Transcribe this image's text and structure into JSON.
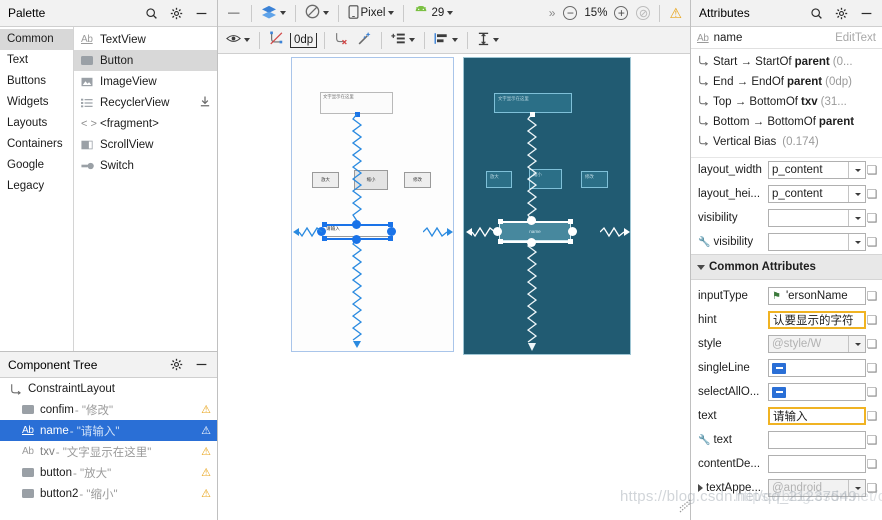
{
  "palette": {
    "header_title": "Palette",
    "icons": [
      "search-icon",
      "gear-icon",
      "minimize-icon"
    ],
    "categories": [
      {
        "label": "Common",
        "selected": true
      },
      {
        "label": "Text",
        "selected": false
      },
      {
        "label": "Buttons",
        "selected": false
      },
      {
        "label": "Widgets",
        "selected": false
      },
      {
        "label": "Layouts",
        "selected": false
      },
      {
        "label": "Containers",
        "selected": false
      },
      {
        "label": "Google",
        "selected": false
      },
      {
        "label": "Legacy",
        "selected": false
      }
    ],
    "items": [
      {
        "label": "TextView",
        "icon": "ab-text-icon",
        "selected": false,
        "download": false
      },
      {
        "label": "Button",
        "icon": "button-icon",
        "selected": true,
        "download": false
      },
      {
        "label": "ImageView",
        "icon": "image-icon",
        "selected": false,
        "download": false
      },
      {
        "label": "RecyclerView",
        "icon": "list-icon",
        "selected": false,
        "download": true
      },
      {
        "label": "<fragment>",
        "icon": "angle-brackets-icon",
        "selected": false,
        "download": false
      },
      {
        "label": "ScrollView",
        "icon": "scrollview-icon",
        "selected": false,
        "download": false
      },
      {
        "label": "Switch",
        "icon": "switch-icon",
        "selected": false,
        "download": false
      }
    ]
  },
  "component_tree": {
    "header_title": "Component Tree",
    "icons": [
      "gear-icon",
      "minimize-icon"
    ],
    "nodes": [
      {
        "name": "ConstraintLayout",
        "value": "",
        "icon": "constraint-icon",
        "depth": 0,
        "selected": false,
        "warning": "",
        "dim": false
      },
      {
        "name": "confim",
        "value": "- \"修改\"",
        "icon": "button-icon",
        "depth": 1,
        "selected": false,
        "warning": "⚠",
        "dim": false
      },
      {
        "name": "name",
        "value": "- \"请输入\"",
        "icon": "ab-text-icon",
        "depth": 1,
        "selected": true,
        "warning": "⚠",
        "dim": false
      },
      {
        "name": "txv",
        "value": "- \"文字显示在这里\"",
        "icon": "ab-text-icon",
        "depth": 1,
        "selected": false,
        "warning": "⚠",
        "dim": true
      },
      {
        "name": "button",
        "value": "- \"放大\"",
        "icon": "button-icon",
        "depth": 1,
        "selected": false,
        "warning": "⚠",
        "dim": false
      },
      {
        "name": "button2",
        "value": "- \"缩小\"",
        "icon": "button-icon",
        "depth": 1,
        "selected": false,
        "warning": "⚠",
        "dim": false
      }
    ]
  },
  "editor_toolbar": {
    "minimize_label": "—",
    "design_mode": "design-surface-icon",
    "orientation": "orientation-icon",
    "device_label": "Pixel",
    "device_icon": "phone-icon",
    "api_label": "29",
    "api_icon": "android-icon",
    "overflow_label": "»",
    "zoom_out_label": "−",
    "zoom_level": "15%",
    "zoom_in_label": "+",
    "zoom_fit_label": "⊘",
    "warning_icon": "warning-icon"
  },
  "constraint_toolbar": {
    "visibility_icon": "eye-icon",
    "autoconnect_icon": "autoconnect-off-icon",
    "margin_value": "0dp",
    "clear_constraints_icon": "clear-constraints-icon",
    "infer_icon": "magic-wand-icon",
    "pack_icon": "pack-icon",
    "align_icon": "align-icon",
    "guidelines_icon": "guidelines-icon"
  },
  "canvas": {
    "design_surface_title": "design-surface",
    "widgets": {
      "txv_text": "文字显示在这里",
      "button_zoom_in": "放大",
      "button_zoom_out": "缩小",
      "button_confirm": "修改",
      "edit_text": "请输入",
      "blueprint_edit_label": "name"
    }
  },
  "watermark": "https://blog.csdn.net/qq_21237549",
  "attributes": {
    "header_title": "Attributes",
    "icons": [
      "search-icon",
      "gear-icon",
      "minimize-icon"
    ],
    "selected_id": "name",
    "selected_type": "EditText",
    "constraints": [
      {
        "text": "Start → StartOf",
        "bold": "parent",
        "muted": "(0..."
      },
      {
        "text": "End → EndOf",
        "bold": "parent",
        "muted": "(0dp)"
      },
      {
        "text": "Top → BottomOf",
        "bold": "txv",
        "muted": "(31..."
      },
      {
        "text": "Bottom → BottomOf",
        "bold": "parent",
        "muted": ""
      },
      {
        "text": "Vertical Bias",
        "bold": "",
        "muted": "(0.174)"
      }
    ],
    "rows_top": [
      {
        "label": "layout_width",
        "value": "p_content",
        "kind": "dropdown",
        "highlight": false,
        "wrench": false
      },
      {
        "label": "layout_hei...",
        "value": "p_content",
        "kind": "dropdown",
        "highlight": false,
        "wrench": false
      },
      {
        "label": "visibility",
        "value": "",
        "kind": "dropdown",
        "highlight": false,
        "wrench": false
      },
      {
        "label": "visibility",
        "value": "",
        "kind": "dropdown",
        "highlight": false,
        "wrench": true
      }
    ],
    "section_common": "Common Attributes",
    "rows_common": [
      {
        "label": "inputType",
        "value": "'ersonName",
        "kind": "flag",
        "highlight": false,
        "wrench": false
      },
      {
        "label": "hint",
        "value": "认要显示的字符",
        "kind": "text",
        "highlight": true,
        "wrench": false
      },
      {
        "label": "style",
        "value": "@style/W",
        "kind": "dropdown-disabled",
        "highlight": false,
        "wrench": false
      },
      {
        "label": "singleLine",
        "value": "",
        "kind": "checkbox",
        "highlight": false,
        "wrench": false
      },
      {
        "label": "selectAllO...",
        "value": "",
        "kind": "checkbox",
        "highlight": false,
        "wrench": false
      },
      {
        "label": "text",
        "value": "请输入",
        "kind": "text",
        "highlight": true,
        "wrench": false
      },
      {
        "label": "text",
        "value": "",
        "kind": "text",
        "highlight": false,
        "wrench": true
      },
      {
        "label": "contentDe...",
        "value": "",
        "kind": "text",
        "highlight": false,
        "wrench": false
      },
      {
        "label": "textAppe...",
        "value": "@android",
        "kind": "dropdown-disabled-tri",
        "highlight": false,
        "wrench": false
      }
    ]
  }
}
